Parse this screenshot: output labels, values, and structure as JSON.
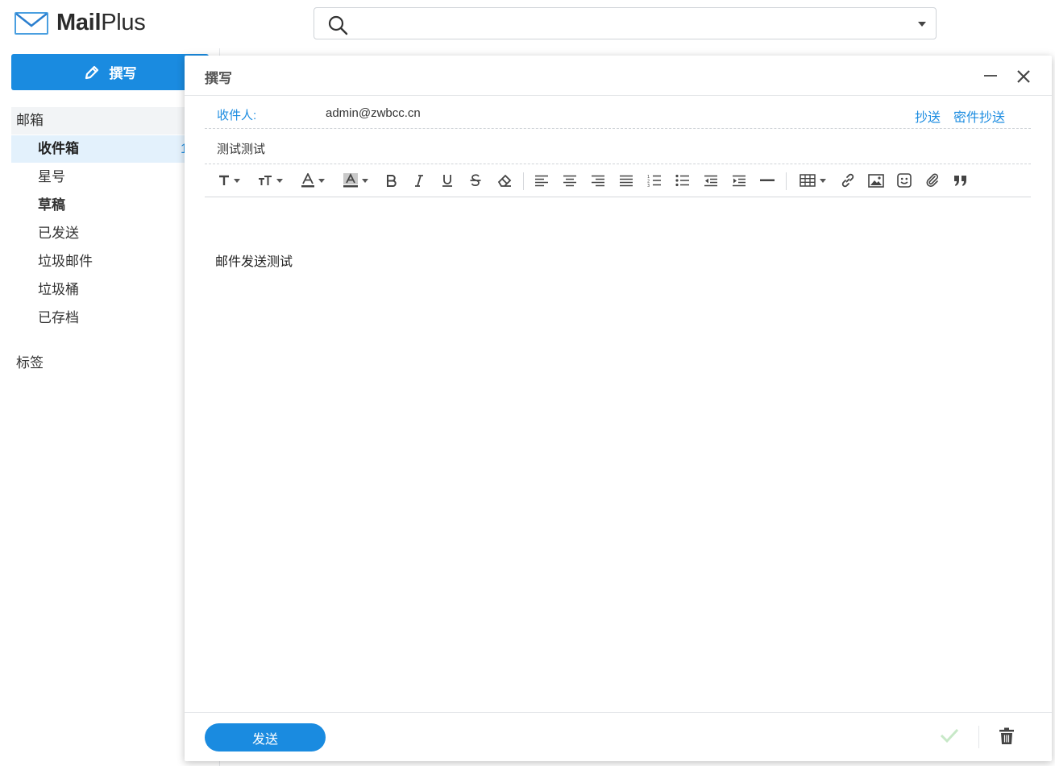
{
  "header": {
    "logo_bold": "Mail",
    "logo_light": "Plus",
    "search": {
      "value": "",
      "placeholder": ""
    }
  },
  "sidebar": {
    "compose_label": "撰写",
    "mailbox_title": "邮箱",
    "folders": [
      {
        "label": "收件箱",
        "count": "1"
      },
      {
        "label": "星号"
      },
      {
        "label": "草稿"
      },
      {
        "label": "已发送"
      },
      {
        "label": "垃圾邮件"
      },
      {
        "label": "垃圾桶"
      },
      {
        "label": "已存档"
      }
    ],
    "tags_title": "标签"
  },
  "compose": {
    "title": "撰写",
    "to_label": "收件人:",
    "to_value": "admin@zwbcc.cn",
    "cc_label": "抄送",
    "bcc_label": "密件抄送",
    "subject": "测试测试",
    "body": "邮件发送测试",
    "send_label": "发送"
  },
  "colors": {
    "accent": "#1a8be0",
    "active_folder_bg": "#e3f1fc"
  },
  "icons": {
    "toolbar": [
      "font-size-icon",
      "text-size-icon",
      "font-color-icon",
      "highlight-icon",
      "bold-icon",
      "italic-icon",
      "underline-icon",
      "strikethrough-icon",
      "clear-format-icon",
      "align-left-icon",
      "align-center-icon",
      "align-right-icon",
      "justify-icon",
      "ordered-list-icon",
      "unordered-list-icon",
      "outdent-icon",
      "indent-icon",
      "horizontal-rule-icon",
      "table-icon",
      "link-icon",
      "image-icon",
      "emoji-icon",
      "attachment-icon",
      "quote-icon"
    ]
  }
}
